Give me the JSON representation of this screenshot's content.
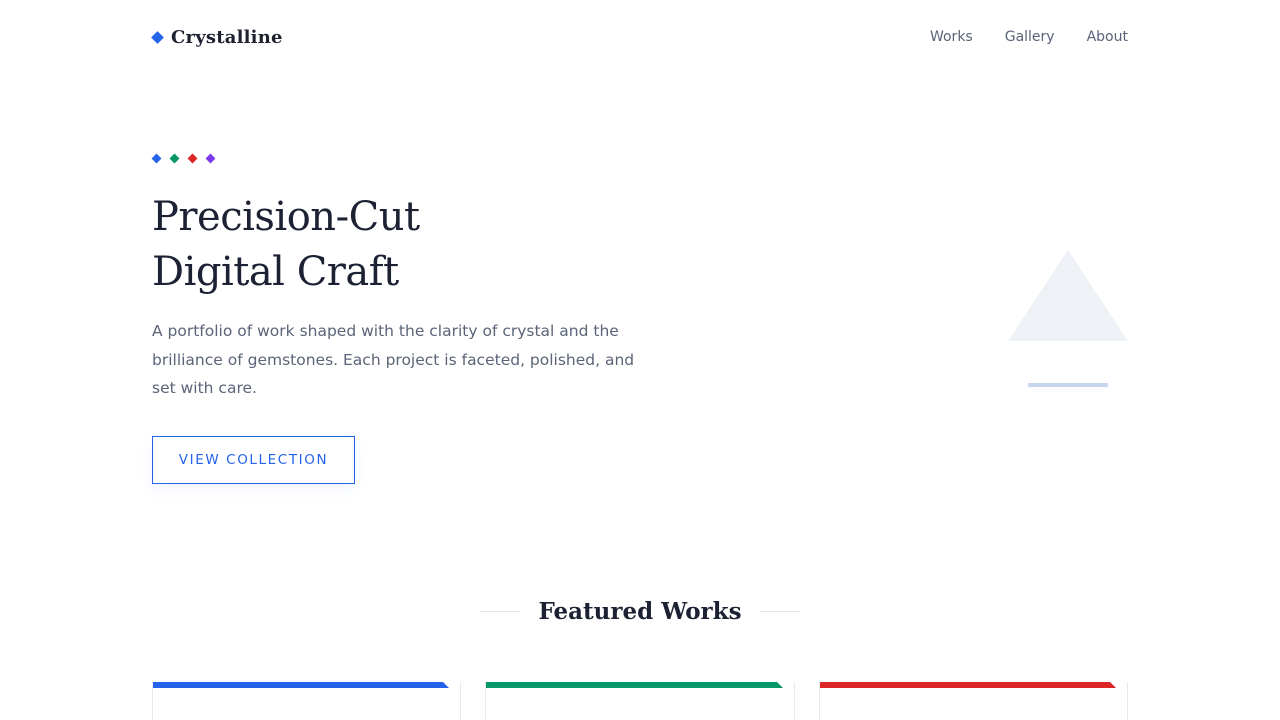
{
  "brand": {
    "name": "Crystalline",
    "color": "#2563eb"
  },
  "nav": {
    "items": [
      "Works",
      "Gallery",
      "About"
    ]
  },
  "hero": {
    "dot_colors": [
      "#2563eb",
      "#059669",
      "#dc2626",
      "#7c3aed"
    ],
    "title_line1": "Precision-Cut",
    "title_line2": "Digital Craft",
    "description": "A portfolio of work shaped with the clarity of crystal and the brilliance of gemstones. Each project is faceted, polished, and set with care.",
    "cta_label": "VIEW COLLECTION"
  },
  "featured": {
    "title": "Featured Works",
    "card_colors": [
      "#2563eb",
      "#059669",
      "#dc2626"
    ]
  }
}
